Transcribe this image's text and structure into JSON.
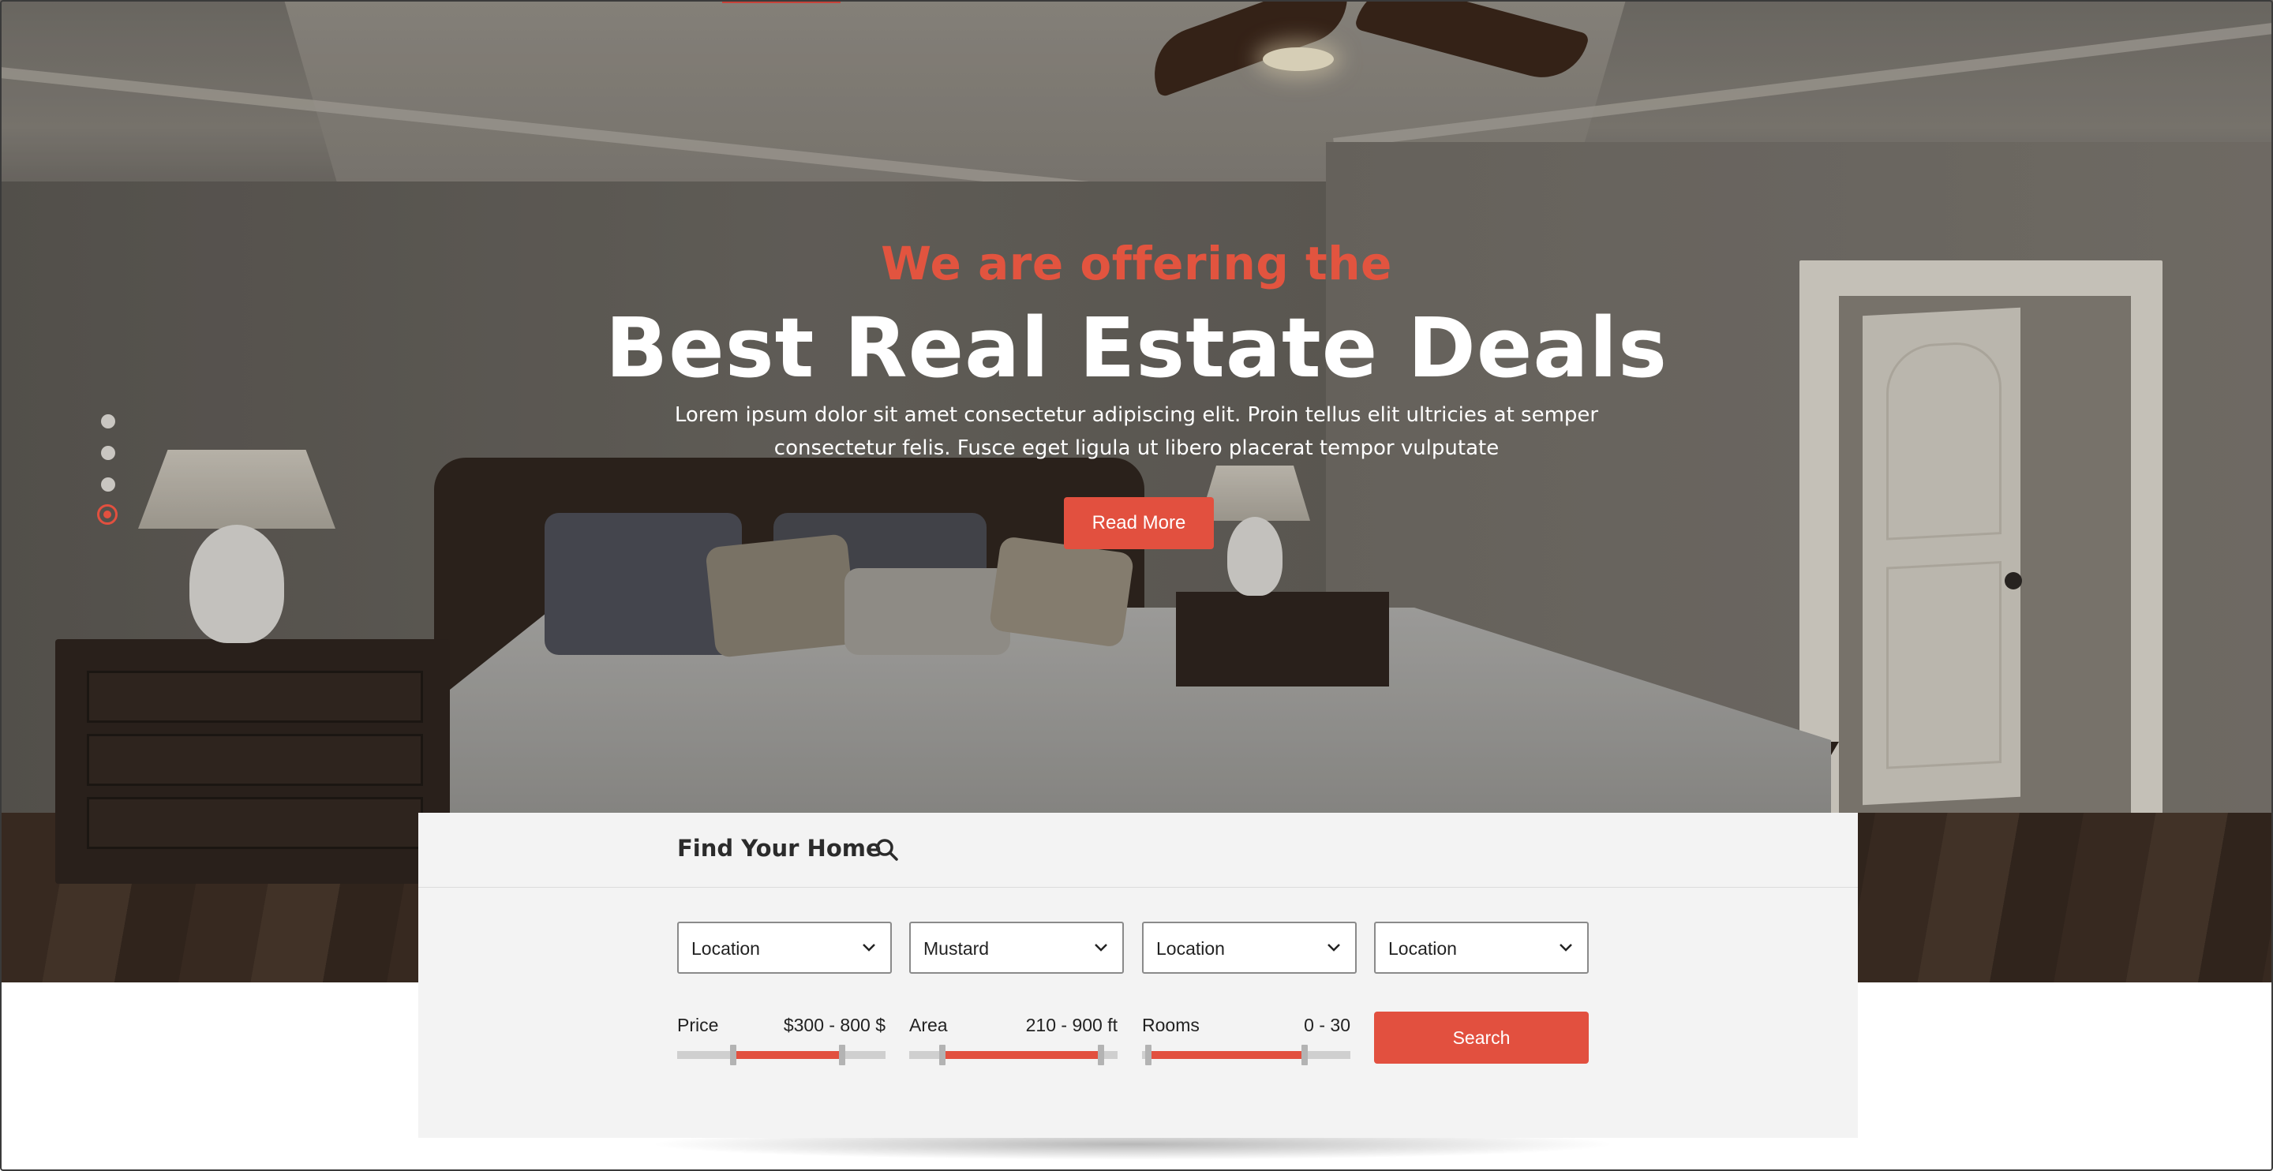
{
  "hero": {
    "kicker": "We are offering the",
    "title": "Best Real Estate Deals",
    "description": "Lorem ipsum dolor sit amet consectetur adipiscing elit. Proin tellus elit ultricies at semper consectetur felis. Fusce eget ligula ut libero placerat tempor vulputate",
    "button_label": "Read More",
    "slides_count": 4,
    "active_slide": 4
  },
  "search_panel": {
    "title": "Find Your Home",
    "title_icon": "search-icon",
    "selects": [
      {
        "value": "Location",
        "icon": "chevron-down-icon"
      },
      {
        "value": "Mustard",
        "icon": "chevron-down-icon"
      },
      {
        "value": "Location",
        "icon": "chevron-down-icon"
      },
      {
        "value": "Location",
        "icon": "chevron-down-icon"
      }
    ],
    "ranges": [
      {
        "label": "Price",
        "value_text": "$300 - 800 $",
        "fill_start": 0.27,
        "fill_end": 0.79
      },
      {
        "label": "Area",
        "value_text": "210 - 900 ft",
        "fill_start": 0.16,
        "fill_end": 0.92
      },
      {
        "label": "Rooms",
        "value_text": "0 - 30",
        "fill_start": 0.03,
        "fill_end": 0.78
      }
    ],
    "search_button": "Search"
  },
  "colors": {
    "accent": "#e2503f",
    "panel_bg": "#f3f3f3",
    "text_dark": "#2b2b2b"
  }
}
